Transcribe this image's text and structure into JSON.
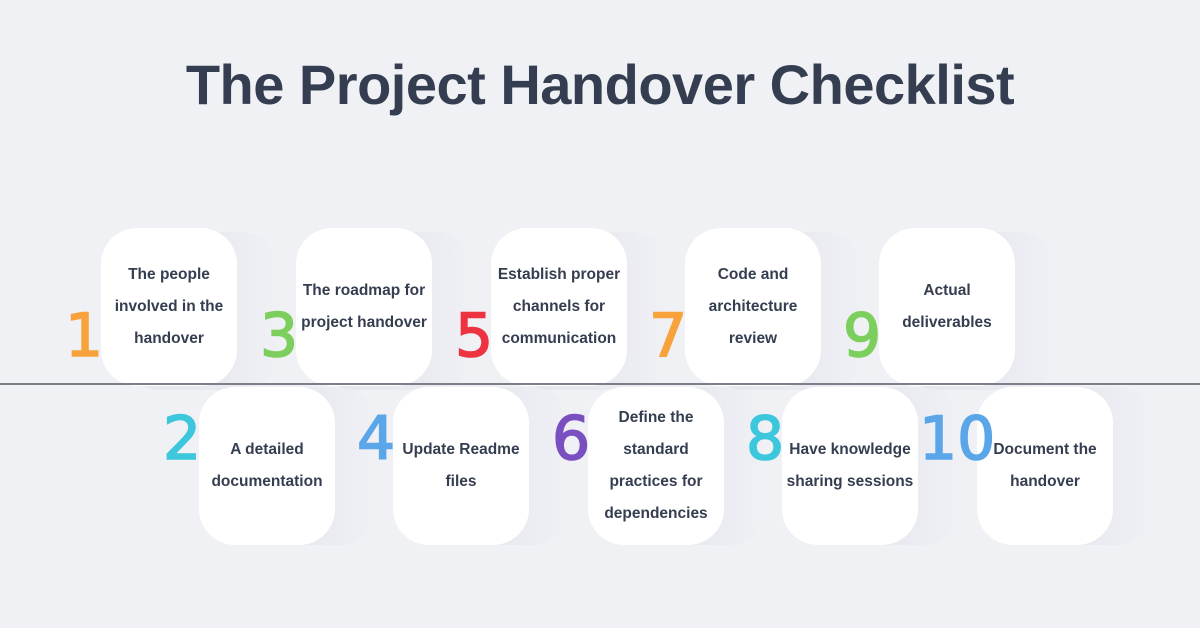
{
  "title": "The Project Handover Checklist",
  "items": [
    {
      "number": "1",
      "text": "The people involved in the handover",
      "color": "#f7a23a"
    },
    {
      "number": "2",
      "text": "A detailed documentation",
      "color": "#3cc7dd"
    },
    {
      "number": "3",
      "text": "The roadmap for project handover",
      "color": "#7ccf5c"
    },
    {
      "number": "4",
      "text": "Update Readme files",
      "color": "#5aa6e8"
    },
    {
      "number": "5",
      "text": "Establish proper channels for communication",
      "color": "#ee3340"
    },
    {
      "number": "6",
      "text": "Define the standard practices for dependencies",
      "color": "#7a4fc0"
    },
    {
      "number": "7",
      "text": "Code and architecture review",
      "color": "#f7a23a"
    },
    {
      "number": "8",
      "text": "Have knowledge sharing sessions",
      "color": "#3cc7dd"
    },
    {
      "number": "9",
      "text": "Actual deliverables",
      "color": "#7ccf5c"
    },
    {
      "number": "10",
      "text": "Document the handover",
      "color": "#5aa6e8"
    }
  ]
}
